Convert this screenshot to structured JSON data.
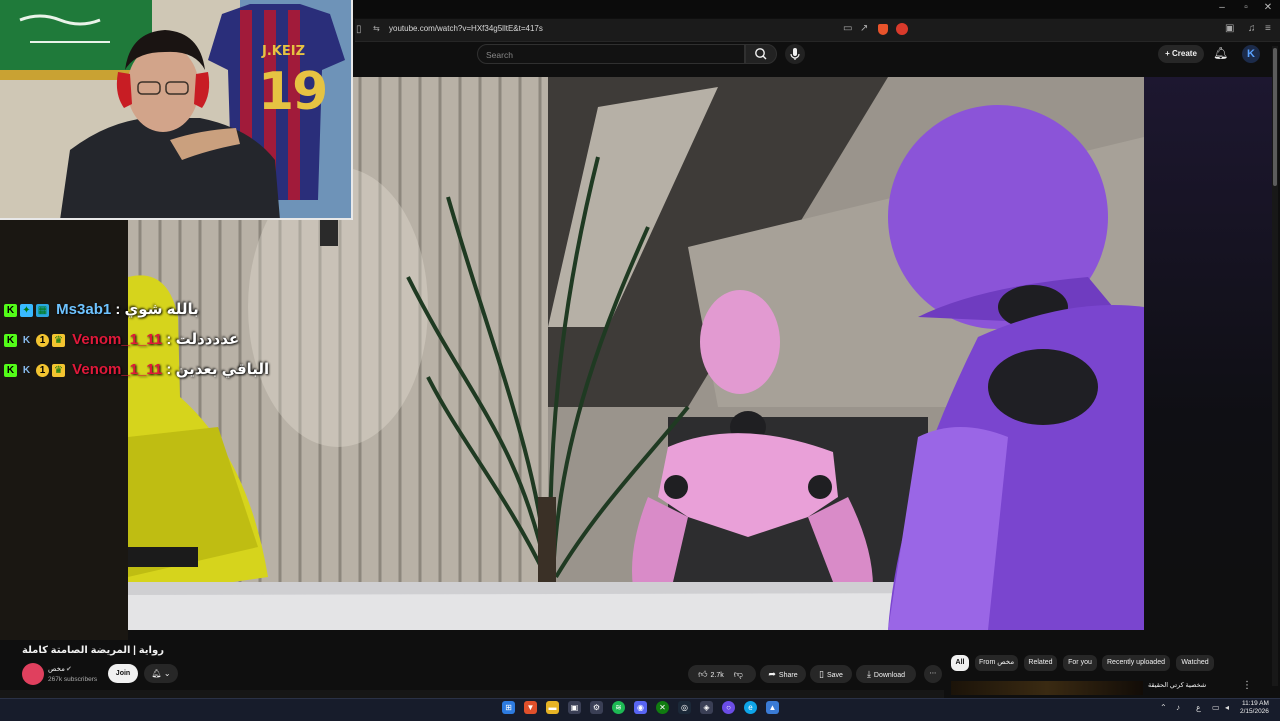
{
  "browser": {
    "url": "youtube.com/watch?v=HXf34g5lltE&t=417s",
    "window_controls": [
      "–",
      "▫",
      "✕"
    ]
  },
  "youtube_header": {
    "search_placeholder": "Search",
    "create_label": "Create",
    "account_initial": "K"
  },
  "chat": [
    {
      "user": "Ms3ab1",
      "message": "بالله شوي",
      "user_color": "#6ec3ff"
    },
    {
      "user": "Venom_1_11",
      "message": "عددددلت",
      "user_color": "#e0193a"
    },
    {
      "user": "Venom_1_11",
      "message": "الباقي بعدين",
      "user_color": "#e0193a"
    }
  ],
  "webcam": {
    "jersey_name": "J.KEIZ",
    "jersey_number": "19"
  },
  "video": {
    "title": "رواية | المريضة الصامتة كاملة",
    "channel_name": "مخص",
    "subscribers": "267k subscribers",
    "join_label": "Join",
    "likes": "2.7k",
    "share_label": "Share",
    "save_label": "Save",
    "download_label": "Download"
  },
  "filter_chips": [
    {
      "label": "All",
      "active": true
    },
    {
      "label": "From مخص",
      "active": false
    },
    {
      "label": "Related",
      "active": false
    },
    {
      "label": "For you",
      "active": false
    },
    {
      "label": "Recently uploaded",
      "active": false
    },
    {
      "label": "Watched",
      "active": false
    }
  ],
  "recommendation": {
    "title": "شخصية كرتي الحقيقة"
  },
  "taskbar": {
    "time": "11:19 AM",
    "date": "2/15/2026",
    "lang": "ع"
  },
  "colors": {
    "background": "#0f0f0f",
    "chip_active": "#f1f1f1",
    "accent_red": "#e0193a",
    "kick_green": "#53fc18"
  }
}
